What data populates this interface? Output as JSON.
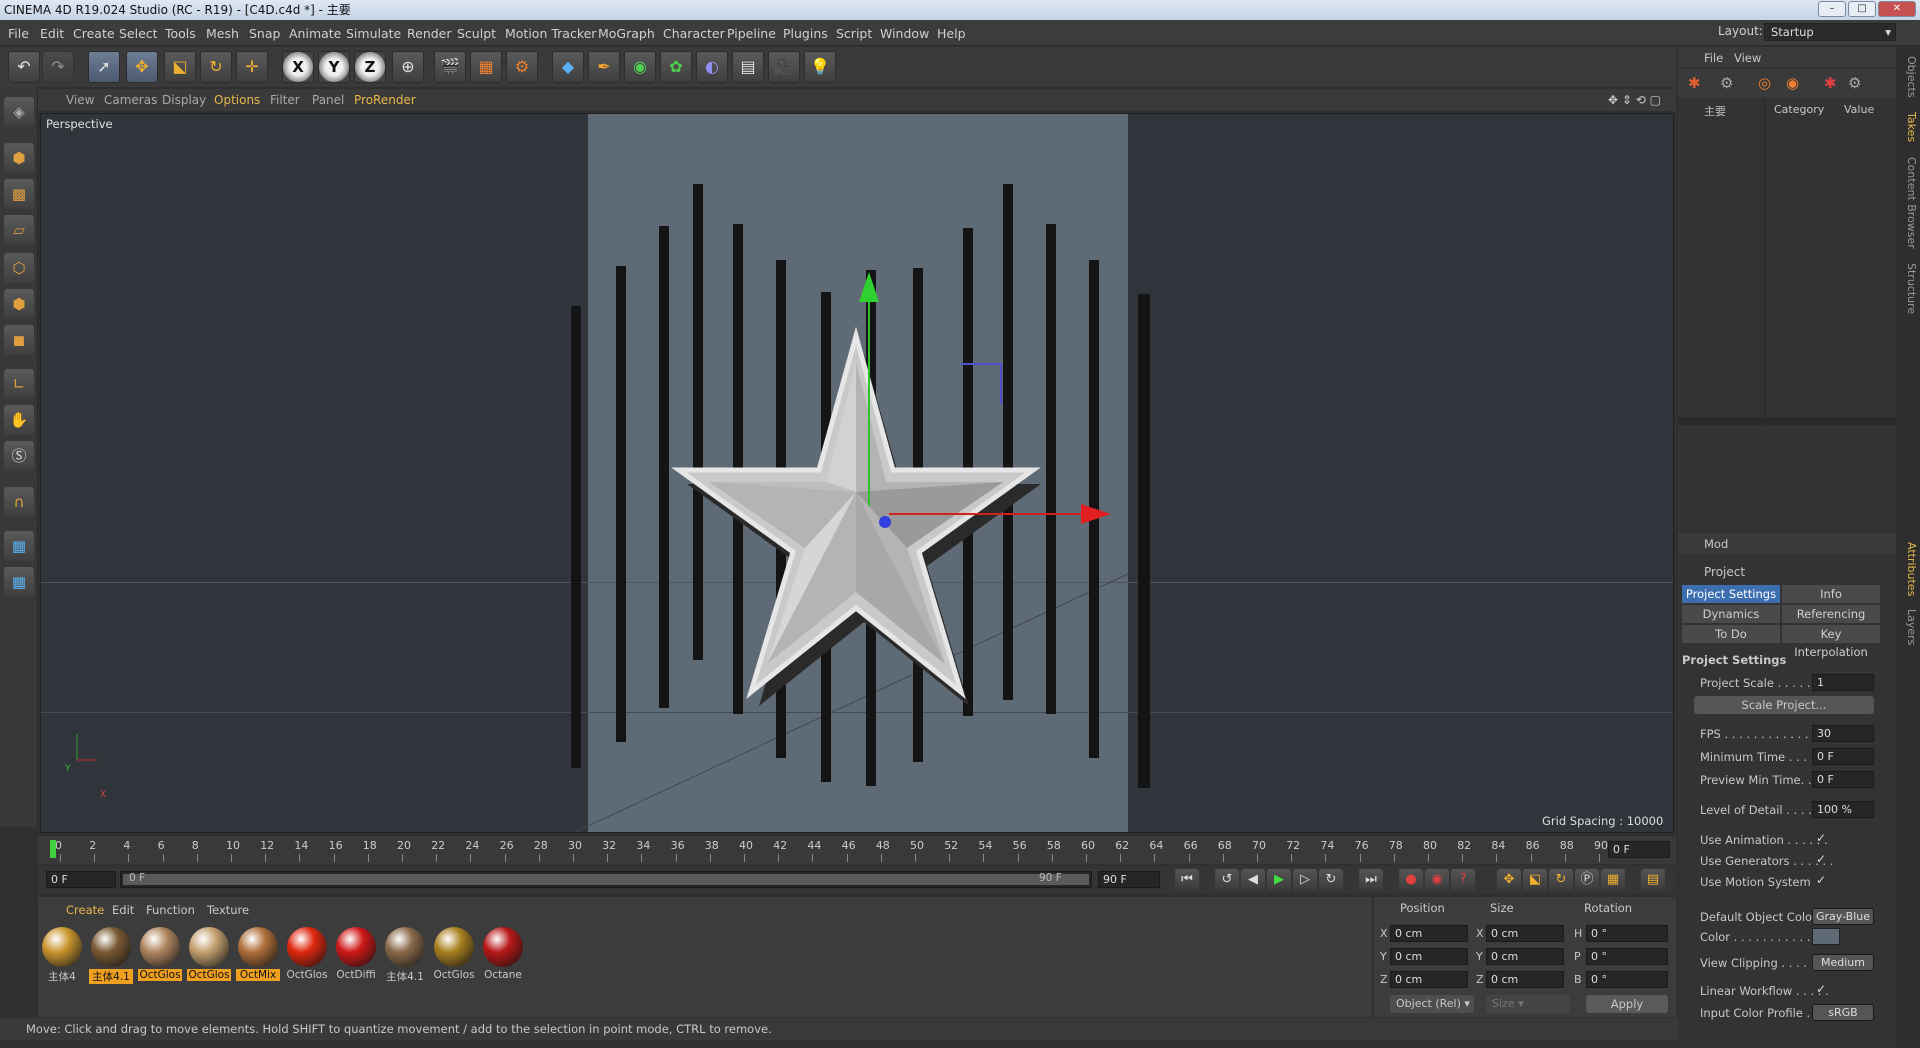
{
  "window": {
    "title": "CINEMA 4D R19.024 Studio (RC - R19) - [C4D.c4d *] - 主要",
    "layout_label": "Layout:",
    "layout_value": "Startup"
  },
  "menus": [
    "File",
    "Edit",
    "Create",
    "Select",
    "Tools",
    "Mesh",
    "Snap",
    "Animate",
    "Simulate",
    "Render",
    "Sculpt",
    "Motion Tracker",
    "MoGraph",
    "Character",
    "Pipeline",
    "Plugins",
    "Script",
    "Window",
    "Help"
  ],
  "toolbar": {
    "axis_x": "X",
    "axis_y": "Y",
    "axis_z": "Z"
  },
  "viewport": {
    "menus": [
      "View",
      "Cameras",
      "Display",
      "Options",
      "Filter",
      "Panel",
      "ProRender"
    ],
    "label": "Perspective",
    "grid_spacing": "Grid Spacing : 10000 cm",
    "axis_y": "Y",
    "axis_x": "X"
  },
  "timeline": {
    "ticks": [
      "0",
      "2",
      "4",
      "6",
      "8",
      "10",
      "12",
      "14",
      "16",
      "18",
      "20",
      "22",
      "24",
      "26",
      "28",
      "30",
      "32",
      "34",
      "36",
      "38",
      "40",
      "42",
      "44",
      "46",
      "48",
      "50",
      "52",
      "54",
      "56",
      "58",
      "60",
      "62",
      "64",
      "66",
      "68",
      "70",
      "72",
      "74",
      "76",
      "78",
      "80",
      "82",
      "84",
      "86",
      "88",
      "90"
    ],
    "current_frame": "0 F",
    "start": "0 F",
    "range_start": "0 F",
    "range_end": "90 F",
    "end": "90 F"
  },
  "materials": {
    "menus": [
      "Create",
      "Edit",
      "Function",
      "Texture"
    ],
    "items": [
      {
        "label": "主体4",
        "color": "#c9962e",
        "selected": false
      },
      {
        "label": "主体4.1",
        "color": "#7a5a34",
        "selected": true
      },
      {
        "label": "OctGlos",
        "color": "#b08660",
        "selected": true
      },
      {
        "label": "OctGlos",
        "color": "#c4a070",
        "selected": true
      },
      {
        "label": "OctMix",
        "color": "#b0703a",
        "selected": true
      },
      {
        "label": "OctGlos",
        "color": "#e02810",
        "selected": false
      },
      {
        "label": "OctDiffi",
        "color": "#d01818",
        "selected": false
      },
      {
        "label": "主体4.1",
        "color": "#8a6a4a",
        "selected": false
      },
      {
        "label": "OctGlos",
        "color": "#a88020",
        "selected": false
      },
      {
        "label": "Octane",
        "color": "#b81818",
        "selected": false
      }
    ]
  },
  "coords": {
    "headers": [
      "Position",
      "Size",
      "Rotation"
    ],
    "pos": [
      {
        "axis": "X",
        "value": "0 cm"
      },
      {
        "axis": "Y",
        "value": "0 cm"
      },
      {
        "axis": "Z",
        "value": "0 cm"
      }
    ],
    "size": [
      {
        "axis": "X",
        "value": "0 cm"
      },
      {
        "axis": "Y",
        "value": "0 cm"
      },
      {
        "axis": "Z",
        "value": "0 cm"
      }
    ],
    "rot": [
      {
        "axis": "H",
        "value": "0 °"
      },
      {
        "axis": "P",
        "value": "0 °"
      },
      {
        "axis": "B",
        "value": "0 °"
      }
    ],
    "mode": "Object (Rel)",
    "size_mode": "Size",
    "apply": "Apply"
  },
  "status": "Move: Click and drag to move elements. Hold SHIFT to quantize movement / add to the selection in point mode, CTRL to remove.",
  "objects_panel": {
    "menus": [
      "File",
      "View"
    ],
    "root": "主要",
    "col_category": "Category",
    "col_value": "Value"
  },
  "vertical_tabs": [
    "Objects",
    "Takes",
    "Content Browser",
    "Structure",
    "Attributes",
    "Layers"
  ],
  "attributes": {
    "mode": "Mod",
    "title": "Project",
    "tabs": [
      {
        "label": "Project Settings",
        "active": true
      },
      {
        "label": "Info",
        "active": false
      },
      {
        "label": "Dynamics",
        "active": false
      },
      {
        "label": "Referencing",
        "active": false
      },
      {
        "label": "To Do",
        "active": false
      },
      {
        "label": "Key Interpolation",
        "active": false
      }
    ],
    "section": "Project Settings",
    "project_scale_label": "Project Scale . . . . . . . .",
    "project_scale": "1",
    "scale_project": "Scale Project...",
    "fps_label": "FPS . . . . . . . . . . . . . . . .",
    "fps": "30",
    "min_time_label": "Minimum Time . . . . . .",
    "min_time": "0 F",
    "preview_min_label": "Preview Min Time. . . .",
    "preview_min": "0 F",
    "lod_label": "Level of Detail . . . . . .",
    "lod": "100 %",
    "use_anim_label": "Use Animation . . . . . .",
    "use_gen_label": "Use Generators . . . . . .",
    "use_motion_label": "Use Motion System",
    "check": "✓",
    "def_obj_color_label": "Default Object Color",
    "def_obj_color": "Gray-Blue",
    "color_label": "Color . . . . . . . . . . . .",
    "view_clip_label": "View Clipping . . . . . . .",
    "view_clip": "Medium",
    "linear_wf_label": "Linear Workflow . . . . .",
    "input_profile_label": "Input Color Profile . . .",
    "input_profile": "sRGB"
  }
}
